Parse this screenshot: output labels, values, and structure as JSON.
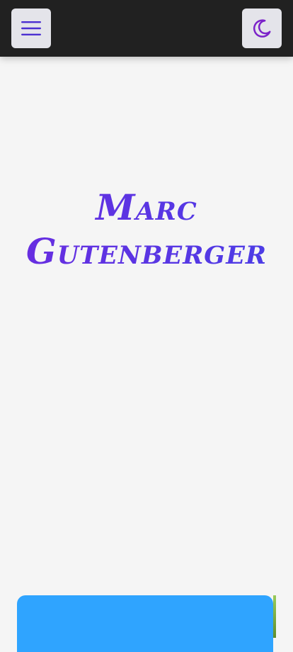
{
  "header": {
    "menu_icon": "hamburger-menu-icon",
    "theme_icon": "moon-icon",
    "background_color": "#212121",
    "button_color": "#e4e4ea",
    "menu_icon_color": "#4b2fd1",
    "theme_icon_color": "#7b22c9"
  },
  "hero": {
    "name_line_1": "Marc",
    "name_line_2": "Gutenberger",
    "accent_color": "#5b2bd9"
  },
  "photo_card": {
    "background_color": "#2fa4ff"
  },
  "page": {
    "background_color": "#f5f5f5"
  }
}
